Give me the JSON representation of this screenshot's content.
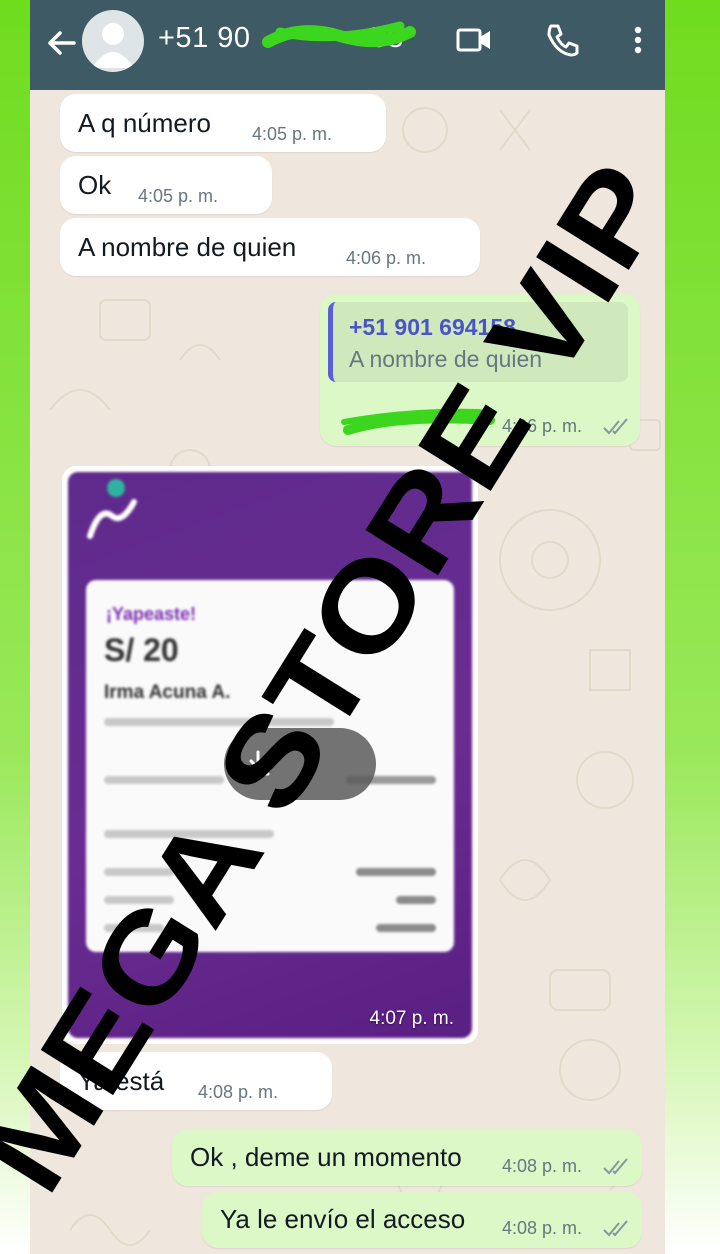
{
  "header": {
    "contact_number": "+51 90",
    "contact_number_end": "58"
  },
  "messages": [
    {
      "id": "m1",
      "direction": "incoming",
      "text": "A q número",
      "time": "4:05 p. m."
    },
    {
      "id": "m2",
      "direction": "incoming",
      "text": "Ok",
      "time": "4:05 p. m."
    },
    {
      "id": "m3",
      "direction": "incoming",
      "text": "A nombre de quien",
      "time": "4:06 p. m."
    },
    {
      "id": "m4",
      "direction": "outgoing",
      "quote_author": "+51 901 694158",
      "quote_text": "A nombre de quien",
      "text": "",
      "time": "4:06 p. m."
    },
    {
      "id": "m5",
      "direction": "incoming",
      "type": "image",
      "time": "4:07 p. m.",
      "image": {
        "header": "¡Yapeaste!",
        "amount": "S/ 20",
        "recipient": "Irma Acuna A."
      }
    },
    {
      "id": "m6",
      "direction": "incoming",
      "text": "Ya está",
      "time": "4:08 p. m."
    },
    {
      "id": "m7",
      "direction": "outgoing",
      "text": "Ok , deme un momento",
      "time": "4:08 p. m."
    },
    {
      "id": "m8",
      "direction": "outgoing",
      "text": "Ya le envío el acceso",
      "time": "4:08 p. m."
    }
  ],
  "watermark": "MEGA STORE VIP",
  "colors": {
    "header": "#3e5a64",
    "incoming_bubble": "#ffffff",
    "outgoing_bubble": "#dcf8c6",
    "quote_accent": "#5a5fd6",
    "redaction": "#3cd61e",
    "yape_purple": "#6a2c92"
  },
  "icons": [
    "back-arrow-icon",
    "avatar-icon",
    "video-call-icon",
    "phone-icon",
    "more-vert-icon",
    "double-check-icon",
    "download-icon"
  ]
}
